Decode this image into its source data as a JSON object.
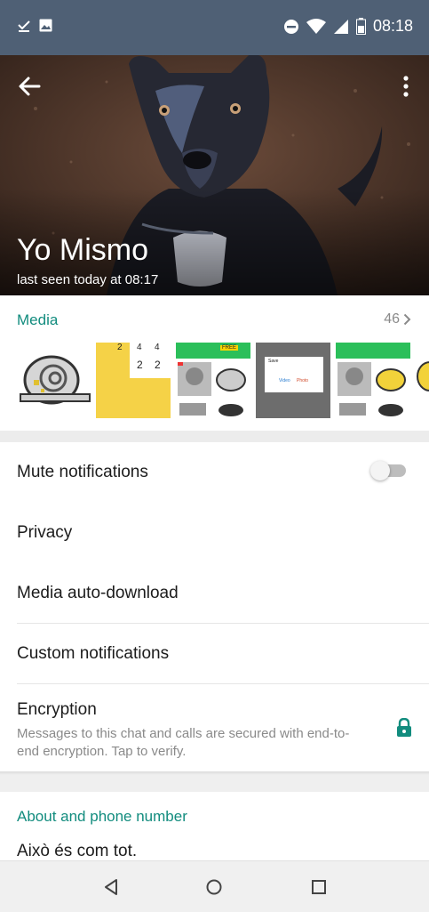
{
  "status_bar": {
    "time": "08:18",
    "icons_left": [
      "download-done-icon",
      "image-icon"
    ],
    "icons_right": [
      "do-not-disturb-icon",
      "wifi-icon",
      "signal-icon",
      "battery-icon"
    ]
  },
  "header": {
    "name": "Yo Mismo",
    "last_seen": "last seen today at 08:17"
  },
  "media": {
    "title": "Media",
    "count": "46",
    "thumb_labels": {
      "grid_cells": [
        "2",
        "4",
        "4",
        "2",
        "2"
      ],
      "free_badge": "FREE",
      "dialog_title": "Save",
      "dialog_option_1": "Video",
      "dialog_option_2": "Photo"
    }
  },
  "settings": {
    "mute": "Mute notifications",
    "privacy": "Privacy",
    "auto_download": "Media auto-download",
    "custom": "Custom notifications",
    "encryption_title": "Encryption",
    "encryption_desc": "Messages to this chat and calls are secured with end-to-end encryption. Tap to verify.",
    "mute_enabled": false
  },
  "about": {
    "title": "About and phone number",
    "text": "Això és com tot."
  },
  "colors": {
    "status_bar": "#4f6075",
    "accent": "#128c7e"
  }
}
